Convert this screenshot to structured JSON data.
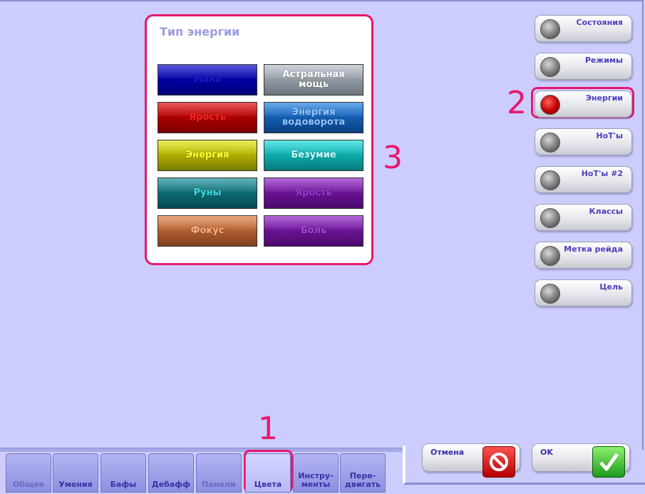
{
  "panel": {
    "title": "Тип энергии",
    "swatches": [
      {
        "label": "Мана",
        "bg": "#0000c8",
        "dark": "#00007a",
        "text": "#1a1ad0"
      },
      {
        "label": "Астральная мощь",
        "bg": "#b4bcc6",
        "dark": "#6d757d",
        "text": "#ffffff"
      },
      {
        "label": "Ярость",
        "bg": "#e00000",
        "dark": "#7a0000",
        "text": "#ff2020"
      },
      {
        "label": "Энергия водоворота",
        "bg": "#1a7be0",
        "dark": "#0a3f80",
        "text": "#8fc4ff"
      },
      {
        "label": "Энергия",
        "bg": "#e0e000",
        "dark": "#7a7a00",
        "text": "#ffff30"
      },
      {
        "label": "Безумие",
        "bg": "#10d8d8",
        "dark": "#087a7a",
        "text": "#c8ffff"
      },
      {
        "label": "Руны",
        "bg": "#0f8a94",
        "dark": "#074a50",
        "text": "#40d8e0"
      },
      {
        "label": "Ярость",
        "bg": "#8a1ac0",
        "dark": "#4a0a6a",
        "text": "#9a3ad0"
      },
      {
        "label": "Фокус",
        "bg": "#e07a40",
        "dark": "#804020",
        "text": "#ffb080"
      },
      {
        "label": "Боль",
        "bg": "#8a1ac0",
        "dark": "#4a0a6a",
        "text": "#9a4ad0"
      }
    ]
  },
  "side_buttons": [
    {
      "label": "Состояния",
      "active": false
    },
    {
      "label": "Режимы",
      "active": false
    },
    {
      "label": "Энергии",
      "active": true
    },
    {
      "label": "HoT'ы",
      "active": false
    },
    {
      "label": "HoT'ы #2",
      "active": false
    },
    {
      "label": "Классы",
      "active": false
    },
    {
      "label": "Метка рейда",
      "active": false
    },
    {
      "label": "Цель",
      "active": false
    }
  ],
  "tabs": [
    {
      "label": "Общее",
      "dim": true
    },
    {
      "label": "Умения",
      "dim": false
    },
    {
      "label": "Бафы",
      "dim": false
    },
    {
      "label": "Дебафф",
      "dim": false
    },
    {
      "label": "Панели",
      "dim": true
    },
    {
      "label": "Цвета",
      "dim": false
    },
    {
      "label": "Инстру-\nменты",
      "dim": false
    },
    {
      "label": "Пере-\nдвигать",
      "dim": false
    }
  ],
  "actions": {
    "cancel_label": "Отмена",
    "ok_label": "OK"
  },
  "annotations": [
    "1",
    "2",
    "3"
  ],
  "colors": {
    "highlight": "#e8176c",
    "background": "#cccdfc"
  }
}
